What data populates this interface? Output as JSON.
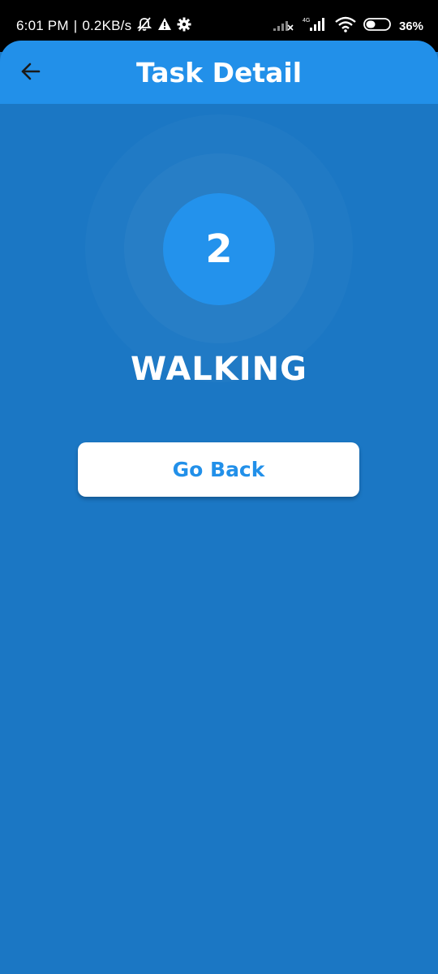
{
  "status_bar": {
    "time": "6:01 PM",
    "separator": "|",
    "net_speed": "0.2KB/s",
    "battery": "36%",
    "network_type": "4G",
    "icons": [
      "bell-off-icon",
      "warning-icon",
      "settings-gear-icon",
      "signal-no-service-icon",
      "signal-4g-icon",
      "wifi-icon",
      "battery-icon"
    ]
  },
  "app_bar": {
    "title": "Task Detail",
    "back_icon": "arrow-left-icon"
  },
  "main": {
    "count": "2",
    "activity": "WALKING",
    "go_back_label": "Go Back"
  },
  "colors": {
    "background": "#1b77c4",
    "app_bar": "#2290e9",
    "circle": "#2392ec",
    "button_text": "#2290e9",
    "button_bg": "#ffffff"
  }
}
